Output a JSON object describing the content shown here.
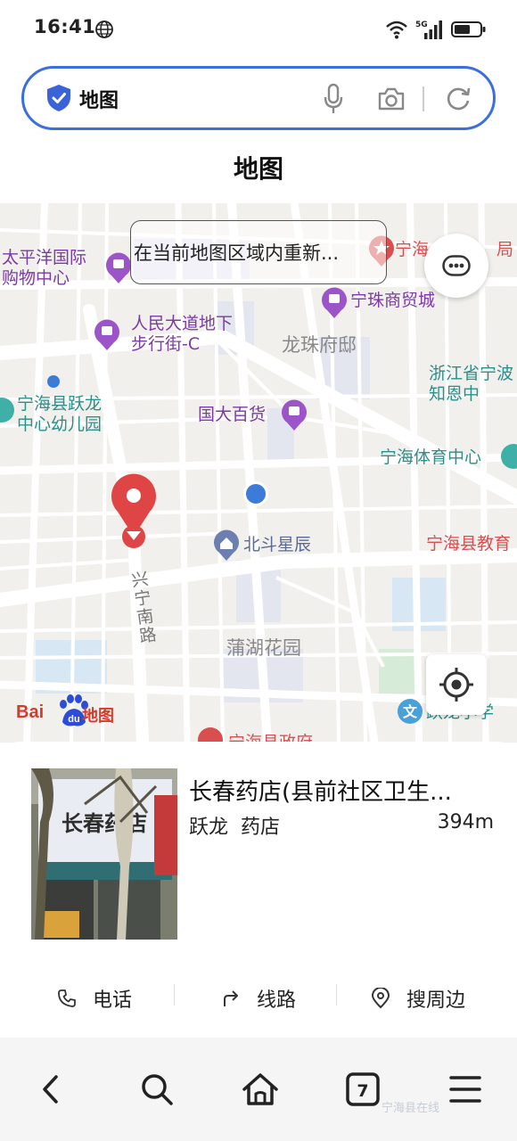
{
  "status_bar": {
    "time": "16:41",
    "network": "5G",
    "icons": [
      "globe-icon",
      "wifi-icon",
      "signal-icon",
      "battery-icon"
    ]
  },
  "search": {
    "query": "地图",
    "icons": [
      "shield-icon",
      "mic-icon",
      "camera-icon",
      "refresh-icon"
    ],
    "accent_color": "#3a6fe0"
  },
  "page": {
    "title": "地图"
  },
  "map": {
    "research_button": "在当前地图区域内重新...",
    "labels": {
      "taipingyang": "太平洋国际\n购物中心",
      "ningzhu_partial": "宁海",
      "ningzhu_partial_right": "局",
      "ningzhu_mall": "宁珠商贸城",
      "renmin_street": "人民大道地下\n步行街-C",
      "longzhu_mansion": "龙珠府邸",
      "zhejiang_partial": "浙江省宁波\n知恩中",
      "kindergarten": "宁海县跃龙\n中心幼儿园",
      "guoda_store": "国大百货",
      "sports_center": "宁海体育中心",
      "education_partial": "宁海县教育",
      "beidou": "北斗星辰",
      "xingning_road": "兴宁南路",
      "puhu_garden": "蒲湖花园",
      "yuelong_school_partial": "跃龙小学",
      "government_partial": "宁海县政府"
    },
    "logo": {
      "bai": "Bai",
      "du": "du",
      "map": "地图"
    },
    "controls": [
      "more-icon",
      "locate-icon"
    ]
  },
  "place": {
    "name": "长春药店(县前社区卫生...",
    "area": "跃龙",
    "category": "药店",
    "distance": "394m",
    "photo_sign": "长春药店"
  },
  "actions": [
    {
      "label": "电话",
      "icon": "phone-icon"
    },
    {
      "label": "线路",
      "icon": "route-icon"
    },
    {
      "label": "搜周边",
      "icon": "location-pin-icon"
    }
  ],
  "bottom_nav": {
    "tab_count": "7",
    "icons": [
      "back-icon",
      "search-icon",
      "home-icon",
      "tabs-icon",
      "menu-icon"
    ]
  },
  "watermark": "宁海县在线"
}
